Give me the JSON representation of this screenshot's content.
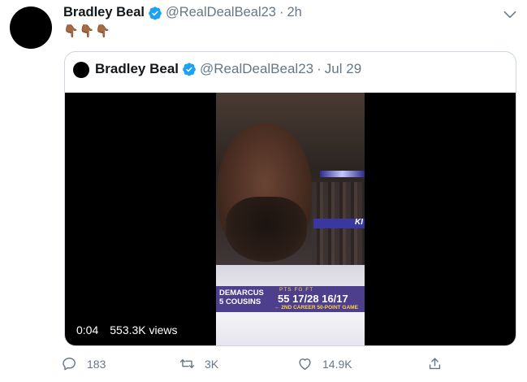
{
  "tweet": {
    "author_name": "Bradley Beal",
    "handle": "@RealDealBeal23",
    "time": "2h",
    "body": "👇🏾👇🏾👇🏾"
  },
  "quoted": {
    "author_name": "Bradley Beal",
    "handle": "@RealDealBeal23",
    "date": "Jul 29",
    "video": {
      "time": "0:04",
      "views": "553.3K views",
      "overlay": {
        "player_first": "DEMARCUS",
        "player_last": "COUSINS",
        "number": "5",
        "stat_labels": "PTS FG FT",
        "stats": "55  17/28  16/17",
        "note": "← 2ND CAREER 50-POINT GAME",
        "banner_text": "KI"
      }
    }
  },
  "actions": {
    "reply_count": "183",
    "retweet_count": "3K",
    "like_count": "14.9K"
  },
  "colors": {
    "verified": "#1da1f2",
    "muted": "#657786",
    "border": "#ccd6dd"
  },
  "icons": [
    "verified-badge-icon",
    "chevron-down-icon",
    "reply-icon",
    "retweet-icon",
    "like-icon",
    "share-icon"
  ]
}
